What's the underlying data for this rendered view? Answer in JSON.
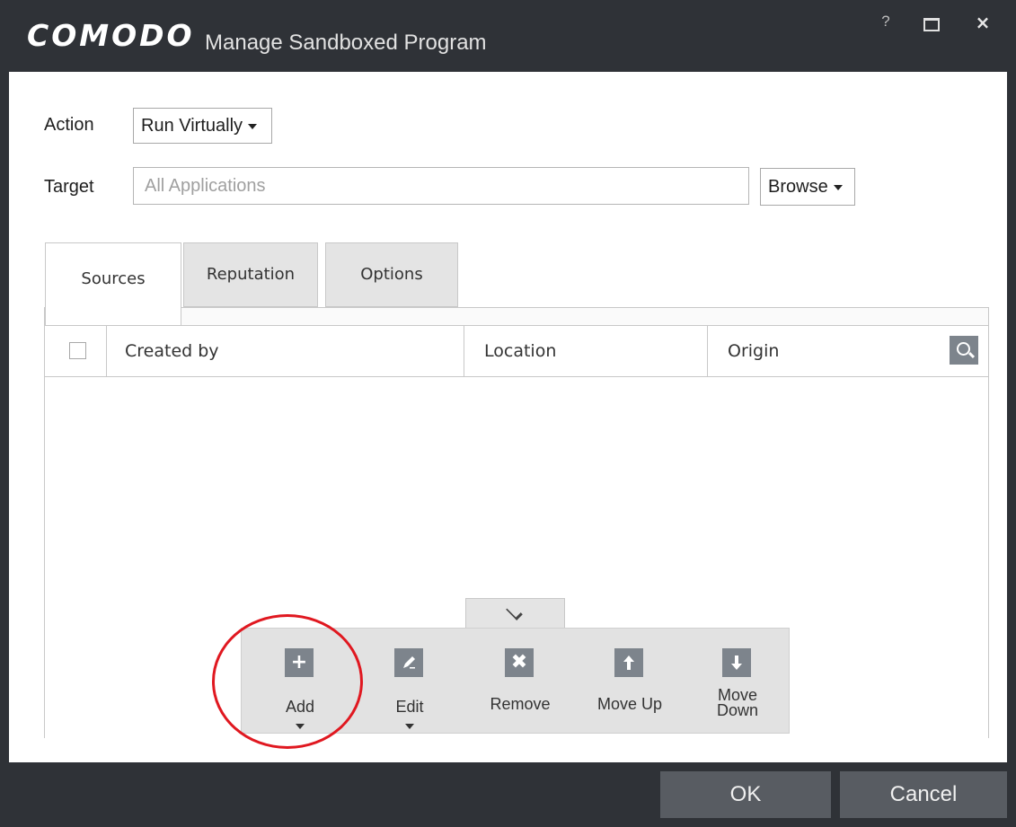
{
  "window": {
    "logo": "COMODO",
    "title": "Manage Sandboxed Program",
    "help_label": "?",
    "close_label": "×"
  },
  "form": {
    "action_label": "Action",
    "action_value": "Run Virtually",
    "target_label": "Target",
    "target_placeholder": "All Applications",
    "browse_label": "Browse"
  },
  "tabs": [
    {
      "label": "Sources",
      "active": true
    },
    {
      "label": "Reputation",
      "active": false
    },
    {
      "label": "Options",
      "active": false
    }
  ],
  "grid": {
    "columns": [
      "Created by",
      "Location",
      "Origin"
    ],
    "rows": []
  },
  "toolbar": {
    "add_label": "Add",
    "edit_label": "Edit",
    "remove_label": "Remove",
    "move_up_label": "Move Up",
    "move_down_label": "Move Down",
    "add_icon": "plus-icon",
    "edit_icon": "pencil-icon",
    "remove_icon": "x-icon",
    "move_up_icon": "arrow-up-icon",
    "move_down_icon": "arrow-down-icon"
  },
  "footer": {
    "ok_label": "OK",
    "cancel_label": "Cancel"
  },
  "colors": {
    "window_bg": "#2f3237",
    "icon_bg": "#7d848c",
    "footer_button": "#585c62",
    "annotation": "#e01820"
  }
}
